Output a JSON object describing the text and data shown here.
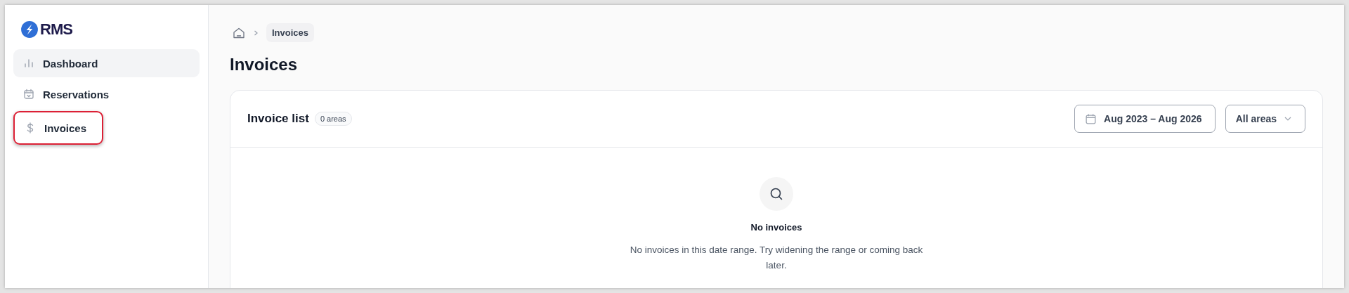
{
  "logo": {
    "text": "RMS"
  },
  "sidebar": {
    "items": [
      {
        "label": "Dashboard",
        "kind": "chart",
        "selected": true,
        "highlighted": false
      },
      {
        "label": "Reservations",
        "kind": "calendar",
        "selected": false,
        "highlighted": false
      },
      {
        "label": "Invoices",
        "kind": "dollar",
        "selected": false,
        "highlighted": true
      }
    ]
  },
  "breadcrumb": [
    "Invoices"
  ],
  "page_title": "Invoices",
  "card": {
    "title": "Invoice list",
    "badge": "0 areas",
    "date_range": "Aug 2023 – Aug 2026",
    "area_filter": "All areas",
    "empty_state": {
      "title": "No invoices",
      "message": "No invoices in this date range. Try widening the range or coming back later."
    }
  }
}
